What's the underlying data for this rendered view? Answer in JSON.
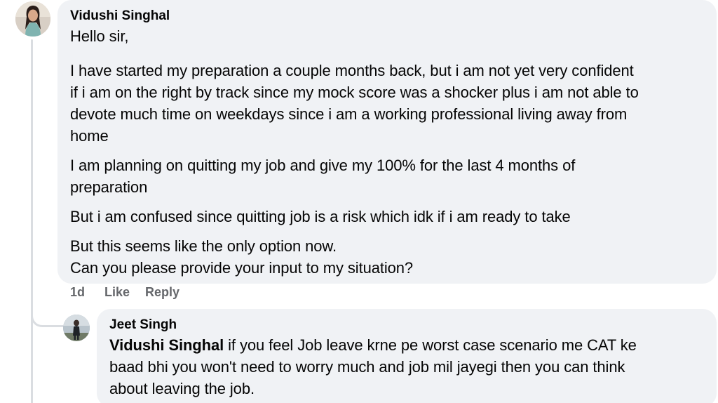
{
  "comments": [
    {
      "author": "Vidushi Singhal",
      "lines": [
        "Hello sir,",
        "I have started my preparation a couple months back, but i am not yet very confident",
        "if i am on the right by track since my mock score was a shocker plus i am not able to",
        "devote much time on weekdays since i am a working professional living away from",
        "home",
        "I am planning on quitting my job and give my 100% for the last 4 months of",
        "preparation",
        "But i am confused since quitting job is a risk which idk if i am ready to take",
        "But this seems like the only option now.",
        "Can you please provide your input to my situation?"
      ],
      "time": "1d",
      "like_label": "Like",
      "reply_label": "Reply"
    }
  ],
  "reply": {
    "author": "Jeet Singh",
    "mention": "Vidushi Singhal",
    "line1_rest": " if you feel Job leave krne pe worst case scenario me CAT ke",
    "line2": "baad bhi you won't need to worry much and job mil jayegi then you can think",
    "line3": "about leaving the job."
  },
  "colors": {
    "bubble": "#f0f2f5",
    "thread_line": "#dadde1",
    "secondary_text": "#65676b"
  }
}
